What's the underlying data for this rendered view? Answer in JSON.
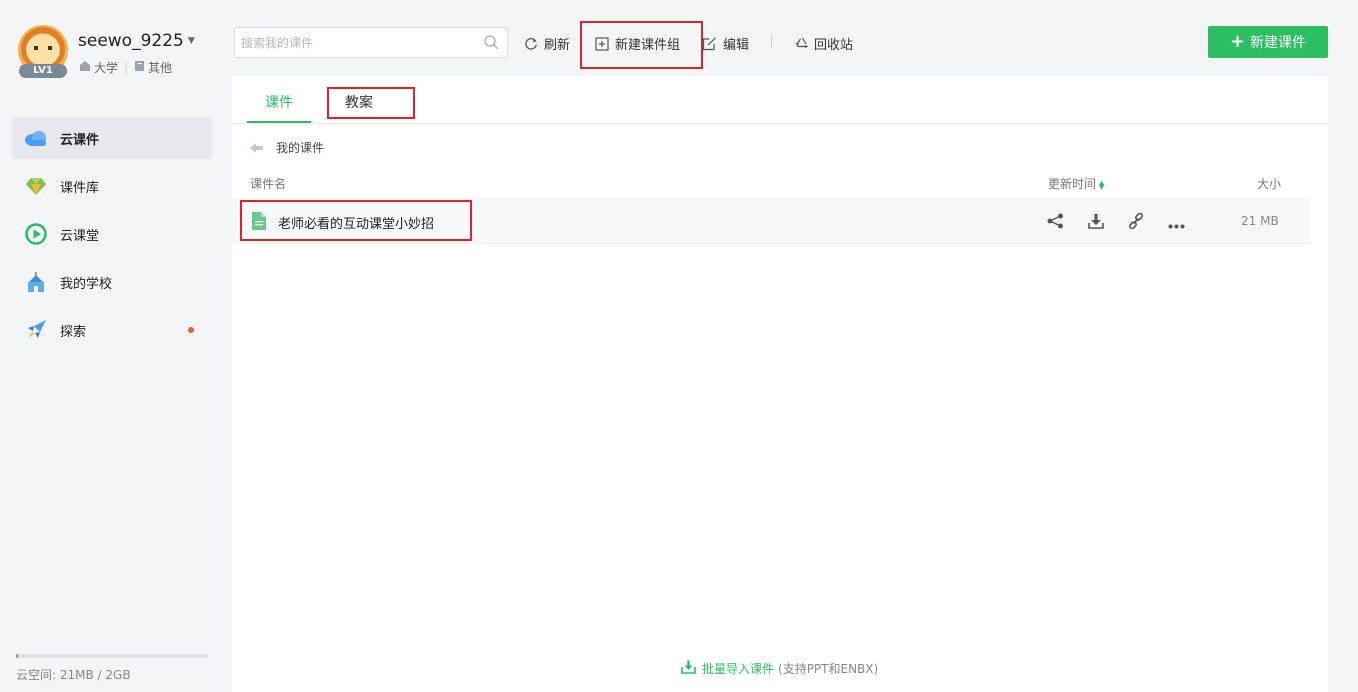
{
  "user": {
    "name": "seewo_9225",
    "level": "LV1",
    "tags": [
      "大学",
      "其他"
    ]
  },
  "nav": {
    "items": [
      {
        "label": "云课件",
        "active": true
      },
      {
        "label": "课件库"
      },
      {
        "label": "云课堂"
      },
      {
        "label": "我的学校"
      },
      {
        "label": "探索",
        "has_dot": true
      }
    ]
  },
  "storage": {
    "text": "云空间:  21MB / 2GB",
    "used_fraction": 0.0103
  },
  "toolbar": {
    "search_placeholder": "搜索我的课件",
    "refresh": "刷新",
    "new_group": "新建课件组",
    "edit": "编辑",
    "recycle": "回收站",
    "new_courseware": "新建课件"
  },
  "tabs": [
    {
      "label": "课件",
      "active": true
    },
    {
      "label": "教案"
    }
  ],
  "breadcrumb": "我的课件",
  "table": {
    "columns": {
      "name": "课件名",
      "updated": "更新时间",
      "size": "大小"
    },
    "rows": [
      {
        "name": "老师必看的互动课堂小妙招",
        "size": "21 MB"
      }
    ]
  },
  "import": {
    "label": "批量导入课件",
    "note": "(支持PPT和ENBX)"
  },
  "colors": {
    "accent": "#2dbd62",
    "annotation": "#d9252d"
  }
}
